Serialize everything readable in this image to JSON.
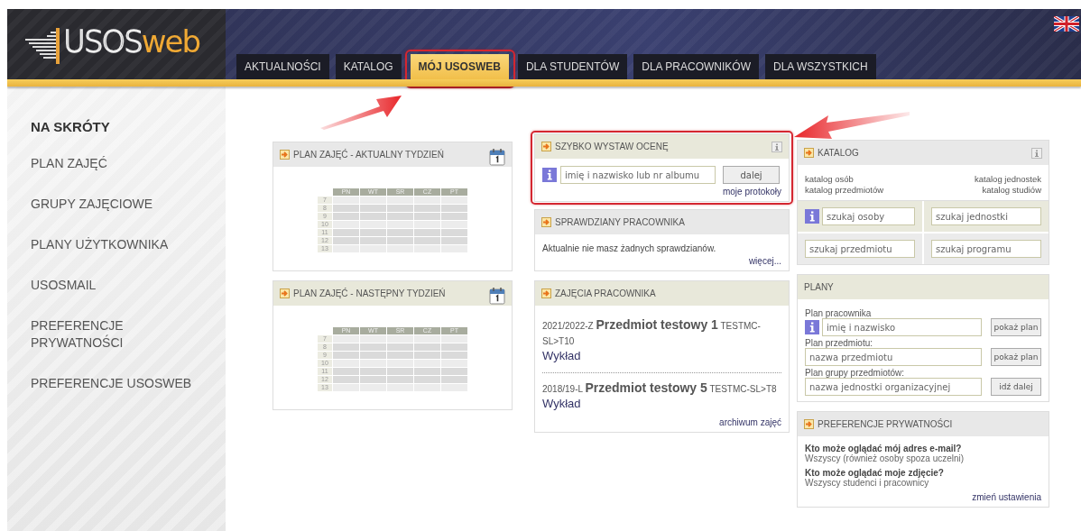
{
  "header": {
    "logo": {
      "text": "USOS",
      "accent": "web"
    },
    "tabs": [
      {
        "label": "AKTUALNOŚCI",
        "selected": false,
        "highlighted": false
      },
      {
        "label": "KATALOG",
        "selected": false,
        "highlighted": false
      },
      {
        "label": "MÓJ USOSWEB",
        "selected": true,
        "highlighted": true
      },
      {
        "label": "DLA STUDENTÓW",
        "selected": false,
        "highlighted": false
      },
      {
        "label": "DLA PRACOWNIKÓW",
        "selected": false,
        "highlighted": false
      },
      {
        "label": "DLA WSZYSTKICH",
        "selected": false,
        "highlighted": false
      }
    ]
  },
  "sidebar": {
    "heading": "NA SKRÓTY",
    "items": [
      "PLAN ZAJĘĆ",
      "GRUPY ZAJĘCIOWE",
      "PLANY UŻYTKOWNIKA",
      "USOSMAIL",
      "PREFERENCJE PRYWATNOŚCI",
      "PREFERENCJE USOSWEB"
    ]
  },
  "columns": [
    {
      "panels": [
        {
          "kind": "schedule",
          "title": "PLAN ZAJĘĆ - AKTUALNY TYDZIEŃ",
          "color": "#e8e8e8",
          "highlighted": false,
          "days": [
            "PN",
            "WT",
            "ŚR",
            "CZ",
            "PT"
          ],
          "hours": [
            "7",
            "8",
            "9",
            "10",
            "11",
            "12",
            "13"
          ]
        },
        {
          "kind": "schedule",
          "title": "PLAN ZAJĘĆ - NASTĘPNY TYDZIEŃ",
          "color": "#e8e8da",
          "highlighted": false,
          "days": [
            "PN",
            "WT",
            "ŚR",
            "CZ",
            "PT"
          ],
          "hours": [
            "7",
            "8",
            "9",
            "10",
            "11",
            "12",
            "13"
          ]
        }
      ]
    },
    {
      "panels": [
        {
          "kind": "quick_grade",
          "title": "SZYBKO WYSTAW OCENĘ",
          "color": "#e8e8da",
          "highlighted": true,
          "placeholder": "imię i nazwisko lub nr albumu",
          "button": "dalej",
          "link": "moje protokoły"
        },
        {
          "kind": "text",
          "title": "SPRAWDZIANY PRACOWNIKA",
          "color": "#e8e8e8",
          "highlighted": false,
          "text": "Aktualnie nie masz żadnych sprawdzianów.",
          "link": "więcej..."
        },
        {
          "kind": "courses",
          "title": "ZAJĘCIA PRACOWNIKA",
          "color": "#e8e8da",
          "highlighted": false,
          "courses": [
            {
              "term": "2021/2022-Z",
              "name": "Przedmiot testowy 1",
              "code": "TESTMC-SL>T10",
              "type": "Wykład"
            },
            {
              "term": "2018/19-L",
              "name": "Przedmiot testowy 5",
              "code": "TESTMC-SL>T8",
              "type": "Wykład"
            }
          ],
          "link": "archiwum zajęć"
        }
      ]
    },
    {
      "panels": [
        {
          "kind": "catalog",
          "title": "KATALOG",
          "color": "#e8e8e8",
          "highlighted": false,
          "links": [
            "katalog osób",
            "katalog jednostek",
            "katalog przedmiotów",
            "katalog studiów"
          ],
          "fields": [
            {
              "placeholder": "szukaj osoby",
              "info": true
            },
            {
              "placeholder": "szukaj jednostki",
              "info": false
            },
            {
              "placeholder": "szukaj przedmiotu",
              "info": false
            },
            {
              "placeholder": "szukaj programu",
              "info": false
            }
          ]
        },
        {
          "kind": "plans",
          "title": "PLANY",
          "color": "#e8e8da",
          "highlighted": false,
          "groups": [
            {
              "label": "Plan pracownika",
              "placeholder": "imię i nazwisko",
              "button": "pokaż plan",
              "info": true
            },
            {
              "label": "Plan przedmiotu:",
              "placeholder": "nazwa przedmiotu",
              "button": "pokaż plan",
              "info": false
            },
            {
              "label": "Plan grupy przedmiotów:",
              "placeholder": "nazwa jednostki organizacyjnej",
              "button": "idź dalej",
              "info": false
            }
          ]
        },
        {
          "kind": "privacy",
          "title": "PREFERENCJE PRYWATNOŚCI",
          "color": "#e8e8e8",
          "highlighted": false,
          "items": [
            {
              "question": "Kto może oglądać mój adres e-mail?",
              "answer": "Wszyscy (również osoby spoza uczelni)"
            },
            {
              "question": "Kto może oglądać moje zdjęcie?",
              "answer": "Wszyscy studenci i pracownicy"
            }
          ],
          "link": "zmień ustawienia"
        }
      ]
    }
  ]
}
